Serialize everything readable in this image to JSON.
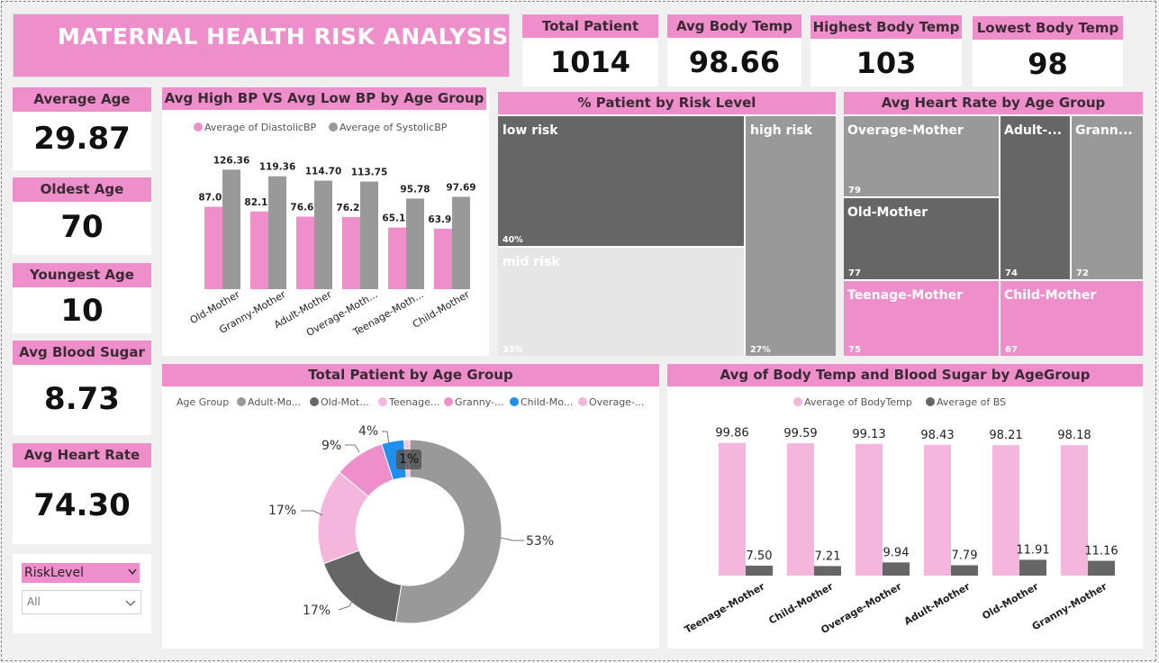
{
  "title": "MATERNAL HEALTH RISK ANALYSIS",
  "kpis_top": [
    {
      "label": "Total Patient",
      "value": "1014"
    },
    {
      "label": "Avg Body Temp",
      "value": "98.66"
    },
    {
      "label": "Highest Body Temp",
      "value": "103"
    },
    {
      "label": "Lowest Body Temp",
      "value": "98"
    }
  ],
  "kpis_left": [
    {
      "label": "Average Age",
      "value": "29.87"
    },
    {
      "label": "Oldest Age",
      "value": "70"
    },
    {
      "label": "Youngest Age",
      "value": "10"
    },
    {
      "label": "Avg Blood Sugar",
      "value": "8.73"
    },
    {
      "label": "Avg Heart Rate",
      "value": "74.30"
    }
  ],
  "slicer": {
    "label": "RiskLevel",
    "value": "All"
  },
  "colors": {
    "pink": "#ee8fcb",
    "light_pink": "#f4b6dc",
    "gray": "#999999",
    "dark_gray": "#666666",
    "light_gray": "#e6e6e6",
    "blue": "#1f8ff0"
  },
  "chart_data": [
    {
      "id": "bp",
      "type": "bar",
      "title": "Avg High BP VS Avg Low BP by Age Group",
      "categories": [
        "Old-Mother",
        "Granny-Mother",
        "Adult-Mother",
        "Overage-Moth...",
        "Teenage-Moth...",
        "Child-Mother"
      ],
      "series": [
        {
          "name": "Average of DiastolicBP",
          "values": [
            87.08,
            82.13,
            76.67,
            76.25,
            65.17,
            63.97
          ]
        },
        {
          "name": "Average of SystolicBP",
          "values": [
            126.36,
            119.36,
            114.7,
            113.75,
            95.78,
            97.69
          ]
        }
      ]
    },
    {
      "id": "risk",
      "type": "treemap",
      "title": "% Patient by Risk Level",
      "items": [
        {
          "label": "low risk",
          "value_label": "40%"
        },
        {
          "label": "mid risk",
          "value_label": "33%"
        },
        {
          "label": "high risk",
          "value_label": "27%"
        }
      ]
    },
    {
      "id": "hr",
      "type": "treemap",
      "title": "Avg Heart Rate by Age Group",
      "items": [
        {
          "label": "Overage-Mother",
          "value": 79
        },
        {
          "label": "Old-Mother",
          "value": 77
        },
        {
          "label": "Adult-...",
          "value": 74
        },
        {
          "label": "Grann...",
          "value": 72
        },
        {
          "label": "Teenage-Mother",
          "value": 75
        },
        {
          "label": "Child-Mother",
          "value": 67
        }
      ]
    },
    {
      "id": "donut",
      "type": "pie",
      "title": "Total Patient by Age Group",
      "legend_title": "Age Group",
      "legend": [
        "Adult-Mo...",
        "Old-Mot...",
        "Teenage...",
        "Granny-...",
        "Child-Mo...",
        "Overage-..."
      ],
      "slices": [
        {
          "name": "Adult-Mother",
          "value": 53,
          "label": "53%"
        },
        {
          "name": "Old-Mother",
          "value": 17,
          "label": "17%"
        },
        {
          "name": "Teenage-Mother",
          "value": 17,
          "label": "17%"
        },
        {
          "name": "Granny-Mother",
          "value": 9,
          "label": "9%"
        },
        {
          "name": "Child-Mother",
          "value": 4,
          "label": "4%"
        },
        {
          "name": "Overage-Mother",
          "value": 1,
          "label": "1%"
        }
      ]
    },
    {
      "id": "temp",
      "type": "bar",
      "title": "Avg of Body Temp and Blood Sugar by AgeGroup",
      "categories": [
        "Teenage-Mother",
        "Child-Mother",
        "Overage-Mother",
        "Adult-Mother",
        "Old-Mother",
        "Granny-Mother"
      ],
      "series": [
        {
          "name": "Average of BodyTemp",
          "values": [
            99.86,
            99.59,
            99.13,
            98.43,
            98.21,
            98.18
          ]
        },
        {
          "name": "Average of BS",
          "values": [
            7.5,
            7.21,
            9.94,
            7.79,
            11.91,
            11.16
          ]
        }
      ]
    }
  ]
}
